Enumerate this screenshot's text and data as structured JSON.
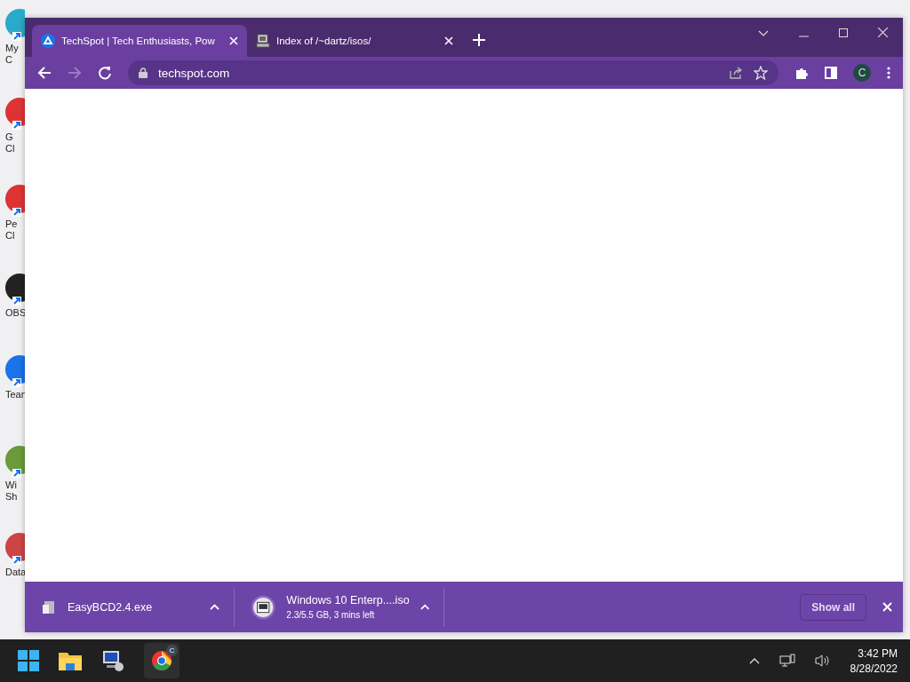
{
  "desktop_icons": [
    {
      "lines": [
        "My C"
      ]
    },
    {
      "lines": [
        "G",
        "Cl"
      ]
    },
    {
      "lines": [
        "Pe",
        "Cl"
      ]
    },
    {
      "lines": [
        "OBS"
      ]
    },
    {
      "lines": [
        "Tean"
      ]
    },
    {
      "lines": [
        "Wi",
        "Sh"
      ]
    },
    {
      "lines": [
        "Data"
      ]
    }
  ],
  "browser": {
    "tabs": [
      {
        "title": "TechSpot | Tech Enthusiasts, Pow",
        "selected": true
      },
      {
        "title": "Index of /~dartz/isos/",
        "selected": false
      }
    ],
    "forward_disabled": true,
    "address": "techspot.com",
    "profile": "C"
  },
  "downloads": [
    {
      "name": "EasyBCD2.4.exe"
    },
    {
      "name": "Windows 10 Enterp....iso",
      "status": "2.3/5.5 GB, 3 mins left",
      "kind": "iso"
    }
  ],
  "show_all": "Show all",
  "taskbar": {
    "chrome_badge": "C",
    "time": "3:42 PM",
    "date": "8/28/2022"
  }
}
